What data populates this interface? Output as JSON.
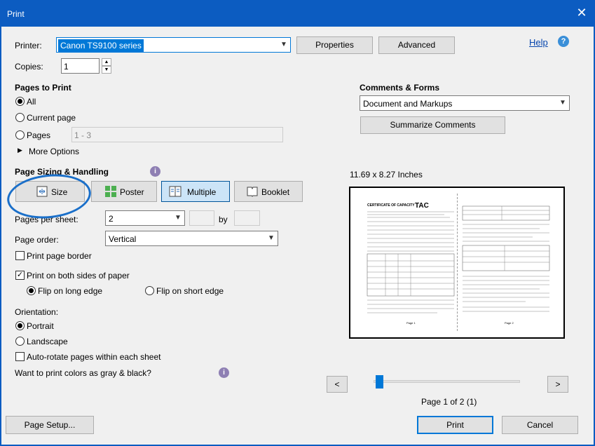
{
  "window": {
    "title": "Print",
    "close_glyph": "✕"
  },
  "printer": {
    "label": "Printer:",
    "selected": "Canon TS9100 series",
    "properties_label": "Properties",
    "advanced_label": "Advanced",
    "help_label": "Help",
    "help_icon": "question-circle-icon"
  },
  "copies": {
    "label": "Copies:",
    "value": "1"
  },
  "pages_to_print": {
    "heading": "Pages to Print",
    "all_label": "All",
    "current_label": "Current page",
    "pages_label": "Pages",
    "pages_value": "1 - 3",
    "more_options_label": "More Options",
    "selected": "All"
  },
  "sizing": {
    "heading": "Page Sizing & Handling",
    "buttons": {
      "size": "Size",
      "poster": "Poster",
      "multiple": "Multiple",
      "booklet": "Booklet"
    },
    "active_mode": "Multiple",
    "pages_per_sheet_label": "Pages per sheet:",
    "pages_per_sheet_value": "2",
    "by_label": "by",
    "page_order_label": "Page order:",
    "page_order_value": "Vertical",
    "print_page_border_label": "Print page border",
    "print_page_border_checked": false,
    "both_sides_label": "Print on both sides of paper",
    "both_sides_checked": true,
    "flip_long_label": "Flip on long edge",
    "flip_short_label": "Flip on short edge",
    "flip_selected": "long"
  },
  "orientation": {
    "heading": "Orientation:",
    "portrait_label": "Portrait",
    "landscape_label": "Landscape",
    "selected": "Portrait",
    "auto_rotate_label": "Auto-rotate pages within each sheet",
    "auto_rotate_checked": false
  },
  "gray_question": "Want to print colors as gray & black?",
  "comments_forms": {
    "heading": "Comments & Forms",
    "value": "Document and Markups",
    "summarize_label": "Summarize Comments"
  },
  "preview": {
    "size_text": "11.69 x 8.27 Inches",
    "page_indicator": "Page 1 of 2 (1)",
    "prev_label": "<",
    "next_label": ">",
    "slider_position": 0,
    "page_left": {
      "heading": "CERTIFICATE OF CAPACITY",
      "logo_text": "TAC",
      "footer": "Page 1"
    },
    "page_right": {
      "footer": "Page 2"
    }
  },
  "footer": {
    "page_setup_label": "Page Setup...",
    "print_label": "Print",
    "cancel_label": "Cancel"
  },
  "colors": {
    "titlebar": "#0c5cc1",
    "selection": "#0078d7",
    "active_mode_bg": "#cce4f7",
    "annotation_ellipse": "#1a6fc9"
  }
}
